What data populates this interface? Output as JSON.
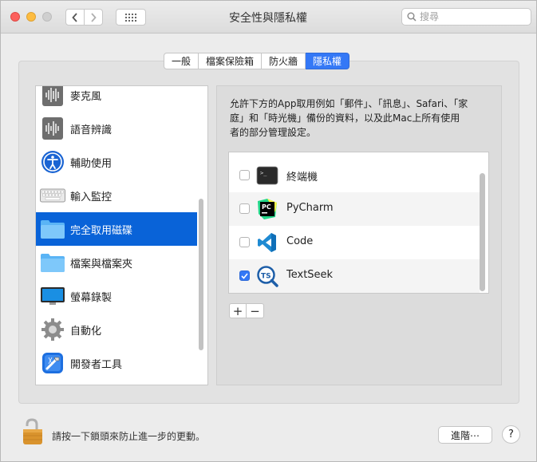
{
  "window": {
    "title": "安全性與隱私權",
    "search_placeholder": "搜尋"
  },
  "tabs": [
    {
      "label": "一般",
      "active": false
    },
    {
      "label": "檔案保險箱",
      "active": false
    },
    {
      "label": "防火牆",
      "active": false
    },
    {
      "label": "隱私權",
      "active": true
    }
  ],
  "sidebar": {
    "items": [
      {
        "label": "麥克風",
        "icon": "microphone-icon"
      },
      {
        "label": "語音辨識",
        "icon": "speech-recognition-icon"
      },
      {
        "label": "輔助使用",
        "icon": "accessibility-icon"
      },
      {
        "label": "輸入監控",
        "icon": "keyboard-icon"
      },
      {
        "label": "完全取用磁碟",
        "icon": "folder-icon",
        "selected": true
      },
      {
        "label": "檔案與檔案夾",
        "icon": "folder-icon"
      },
      {
        "label": "螢幕錄製",
        "icon": "display-icon"
      },
      {
        "label": "自動化",
        "icon": "gear-icon"
      },
      {
        "label": "開發者工具",
        "icon": "developer-tools-icon"
      }
    ]
  },
  "main": {
    "description": "允許下方的App取用例如「郵件」、「訊息」、Safari、「家庭」和「時光機」備份的資料，以及此Mac上所有使用者的部分管理設定。",
    "apps": [
      {
        "label": "終端機",
        "checked": false,
        "icon": "terminal-icon"
      },
      {
        "label": "PyCharm",
        "checked": false,
        "icon": "pycharm-icon"
      },
      {
        "label": "Code",
        "checked": false,
        "icon": "vscode-icon"
      },
      {
        "label": "TextSeek",
        "checked": true,
        "icon": "textseek-icon"
      }
    ],
    "add_label": "+",
    "remove_label": "−"
  },
  "footer": {
    "lock_text": "請按一下鎖頭來防止進一步的更動。",
    "advanced_label": "進階⋯",
    "help_label": "?"
  },
  "colors": {
    "accent": "#3478f6",
    "selection": "#0963d8"
  }
}
